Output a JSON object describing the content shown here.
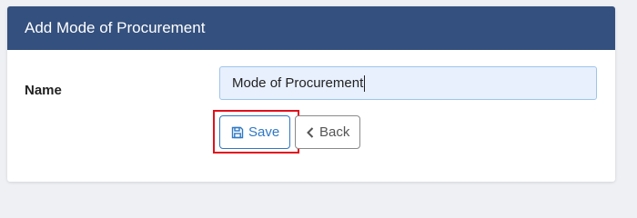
{
  "header": {
    "title": "Add Mode of Procurement"
  },
  "form": {
    "name_label": "Name",
    "name_value": "Mode of Procurement"
  },
  "buttons": {
    "save_label": "Save",
    "back_label": "Back"
  },
  "colors": {
    "header_bg": "#34507e",
    "save_accent": "#2f78c4",
    "highlight": "#e0101b",
    "input_bg": "#e8f0fe"
  },
  "icons": {
    "save": "floppy-disk-icon",
    "back": "chevron-left-icon"
  }
}
